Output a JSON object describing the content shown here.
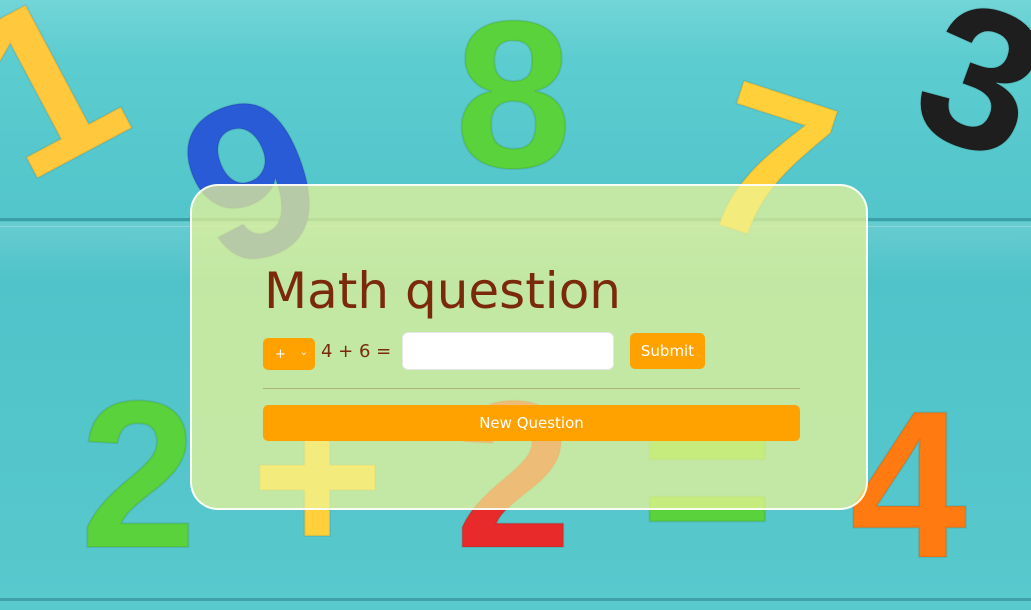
{
  "background": {
    "digits": [
      {
        "char": "1",
        "color": "#ffc83d",
        "icon": "number-1-magnet"
      },
      {
        "char": "8",
        "color": "#5ad23c",
        "icon": "number-8-magnet"
      },
      {
        "char": "9",
        "color": "#2a5bd7",
        "icon": "number-9-magnet"
      },
      {
        "char": "7",
        "color": "#ffd03a",
        "icon": "number-7-magnet"
      },
      {
        "char": "3",
        "color": "#1e1e1e",
        "icon": "number-3-magnet"
      },
      {
        "char": "2",
        "color": "#5ad23c",
        "icon": "number-2-magnet"
      },
      {
        "char": "+",
        "color": "#ffd03a",
        "icon": "plus-magnet"
      },
      {
        "char": "2",
        "color": "#e82a2a",
        "icon": "number-2-magnet"
      },
      {
        "char": "=",
        "color": "#5ad23c",
        "icon": "equals-magnet"
      },
      {
        "char": "4",
        "color": "#ff7a10",
        "icon": "number-4-magnet"
      }
    ]
  },
  "card": {
    "title": "Math question",
    "operator": {
      "selected": "+",
      "options": [
        "+"
      ]
    },
    "equation": "4 + 6 =",
    "answer": {
      "value": "",
      "placeholder": ""
    },
    "submit_label": "Submit",
    "new_question_label": "New Question"
  },
  "colors": {
    "accent": "#ffa200",
    "title": "#7a2a0a",
    "card_bg": "#eef596"
  }
}
